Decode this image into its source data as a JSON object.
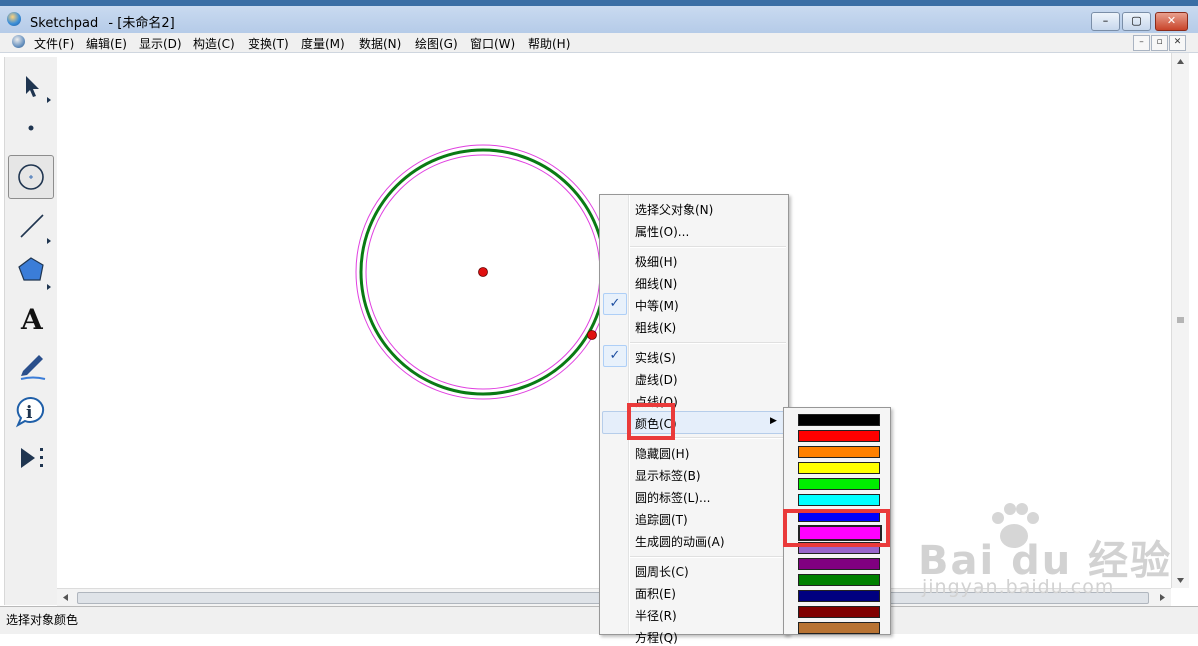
{
  "window": {
    "app_title": "Sketchpad",
    "doc_title": "- [未命名2]",
    "btn_min": "–",
    "btn_max": "▢",
    "btn_close": "✕"
  },
  "menubar": {
    "items": [
      "文件(F)",
      "编辑(E)",
      "显示(D)",
      "构造(C)",
      "变换(T)",
      "度量(M)",
      "数据(N)",
      "绘图(G)",
      "窗口(W)",
      "帮助(H)"
    ],
    "mdi_min": "–",
    "mdi_restore": "▫",
    "mdi_close": "✕"
  },
  "toolbox": {
    "tools": [
      {
        "name": "arrow-tool-icon"
      },
      {
        "name": "point-tool-icon"
      },
      {
        "name": "compass-tool-icon",
        "selected": true
      },
      {
        "name": "straightedge-tool-icon"
      },
      {
        "name": "polygon-tool-icon"
      },
      {
        "name": "text-tool-icon",
        "glyph": "A"
      },
      {
        "name": "marker-tool-icon"
      },
      {
        "name": "information-tool-icon",
        "glyph": "i"
      },
      {
        "name": "custom-tool-icon"
      }
    ]
  },
  "canvas": {
    "circle_stroke_color": "#0a7a14",
    "circle_highlight_color": "#e040e0",
    "point_color": "#e01010"
  },
  "context_menu": {
    "items": [
      {
        "label": "选择父对象(N)"
      },
      {
        "label": "属性(O)..."
      },
      {
        "label": "极细(H)"
      },
      {
        "label": "细线(N)"
      },
      {
        "label": "中等(M)",
        "checked": true
      },
      {
        "label": "粗线(K)"
      },
      {
        "label": "实线(S)",
        "checked": true
      },
      {
        "label": "虚线(D)"
      },
      {
        "label": "点线(O)"
      },
      {
        "label": "颜色(C)",
        "submenu": true
      },
      {
        "label": "隐藏圆(H)"
      },
      {
        "label": "显示标签(B)"
      },
      {
        "label": "圆的标签(L)..."
      },
      {
        "label": "追踪圆(T)"
      },
      {
        "label": "生成圆的动画(A)"
      },
      {
        "label": "圆周长(C)"
      },
      {
        "label": "面积(E)"
      },
      {
        "label": "半径(R)"
      },
      {
        "label": "方程(Q)"
      }
    ],
    "check_glyph": "✓",
    "submenu_arrow": "▶"
  },
  "color_submenu": {
    "colors": [
      "#000000",
      "#ff0000",
      "#ff8000",
      "#ffff00",
      "#00ee00",
      "#00ffff",
      "#0000ff",
      "#ff00ff",
      "#9966cc",
      "#800080",
      "#008000",
      "#000080",
      "#800000",
      "#b87333"
    ],
    "selected_index": 7
  },
  "status_bar": {
    "text": "选择对象颜色"
  },
  "watermark": {
    "brand": "Bai du 经验",
    "url": "jingyan.baidu.com"
  }
}
